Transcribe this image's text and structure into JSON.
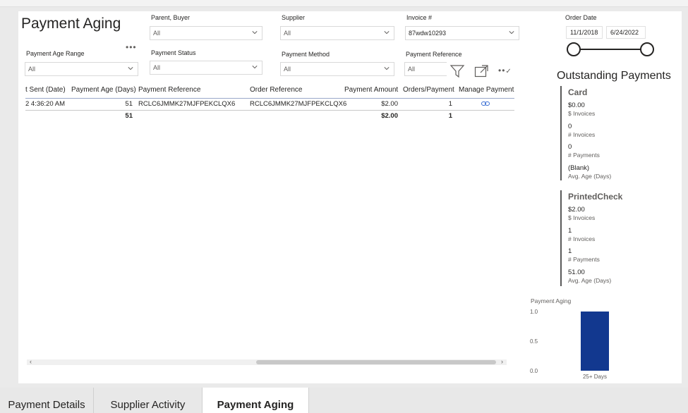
{
  "page": {
    "title": "Payment Aging"
  },
  "filters": {
    "parent_buyer": {
      "label": "Parent, Buyer",
      "value": "All"
    },
    "supplier": {
      "label": "Supplier",
      "value": "All"
    },
    "invoice": {
      "label": "Invoice #",
      "value": "87wdw10293"
    },
    "order_date": {
      "label": "Order Date",
      "start": "11/1/2018",
      "end": "6/24/2022"
    },
    "payment_age_range": {
      "label": "Payment Age Range",
      "value": "All"
    },
    "payment_status": {
      "label": "Payment Status",
      "value": "All"
    },
    "payment_method": {
      "label": "Payment Method",
      "value": "All"
    },
    "payment_reference": {
      "label": "Payment Reference",
      "value": "All"
    }
  },
  "table": {
    "columns": [
      "t Sent (Date)",
      "Payment Age (Days)",
      "Payment Reference",
      "Order Reference",
      "Payment Amount",
      "Orders/Payment",
      "Manage Payment"
    ],
    "rows": [
      [
        "2 4:36:20 AM",
        "51",
        "RCLC6JMMK27MJFPEKCLQX6",
        "RCLC6JMMK27MJFPEKCLQX6",
        "$2.00",
        "1",
        "link-icon"
      ]
    ],
    "totals": [
      "",
      "51",
      "",
      "",
      "$2.00",
      "1",
      ""
    ]
  },
  "outstanding": {
    "title": "Outstanding Payments",
    "groups": [
      {
        "name": "Card",
        "items": [
          {
            "value": "$0.00",
            "label": "$ Invoices"
          },
          {
            "value": "0",
            "label": "# Invoices"
          },
          {
            "value": "0",
            "label": "# Payments"
          },
          {
            "value": "(Blank)",
            "label": "Avg. Age (Days)"
          }
        ]
      },
      {
        "name": "PrintedCheck",
        "items": [
          {
            "value": "$2.00",
            "label": "$ Invoices"
          },
          {
            "value": "1",
            "label": "# Invoices"
          },
          {
            "value": "1",
            "label": "# Payments"
          },
          {
            "value": "51.00",
            "label": "Avg. Age (Days)"
          }
        ]
      }
    ]
  },
  "chart_data": {
    "type": "bar",
    "title": "Payment Aging",
    "categories": [
      "25+ Days"
    ],
    "values": [
      1.0
    ],
    "ylim": [
      0,
      1.0
    ],
    "yticks": [
      "1.0",
      "0.5",
      "0.0"
    ],
    "color": "#12388f",
    "xlabel": "",
    "ylabel": ""
  },
  "tabs": [
    {
      "label": "Payment Details",
      "active": false
    },
    {
      "label": "Supplier Activity",
      "active": false
    },
    {
      "label": "Payment Aging",
      "active": true
    }
  ],
  "colors": {
    "bar": "#12388f",
    "link": "#3b6fd4"
  }
}
